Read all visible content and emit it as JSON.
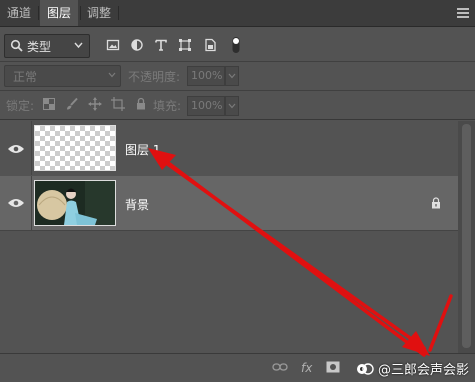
{
  "tabs": [
    {
      "label": "通道",
      "active": false
    },
    {
      "label": "图层",
      "active": true
    },
    {
      "label": "调整",
      "active": false
    }
  ],
  "filter": {
    "kind_label": "类型",
    "icons": [
      "image-filter-icon",
      "adjustment-filter-icon",
      "type-filter-icon",
      "shape-filter-icon",
      "smart-object-filter-icon",
      "filter-toggle-icon"
    ]
  },
  "blend": {
    "mode": "正常",
    "opacity_label": "不透明度:",
    "opacity_value": "100%"
  },
  "lock": {
    "label": "锁定:",
    "fill_label": "填充:",
    "fill_value": "100%"
  },
  "layers": [
    {
      "name": "图层 1",
      "visible": true,
      "selected": false,
      "thumbnail": "transparent",
      "locked": false
    },
    {
      "name": "背景",
      "visible": true,
      "selected": true,
      "thumbnail": "photo",
      "locked": true
    }
  ],
  "bottom": {
    "fx_label": "fx",
    "watermark": "@三郎会声会影"
  },
  "colors": {
    "panel_bg": "#535353",
    "selected_row": "#666666",
    "annotation_arrow": "#e01010"
  }
}
